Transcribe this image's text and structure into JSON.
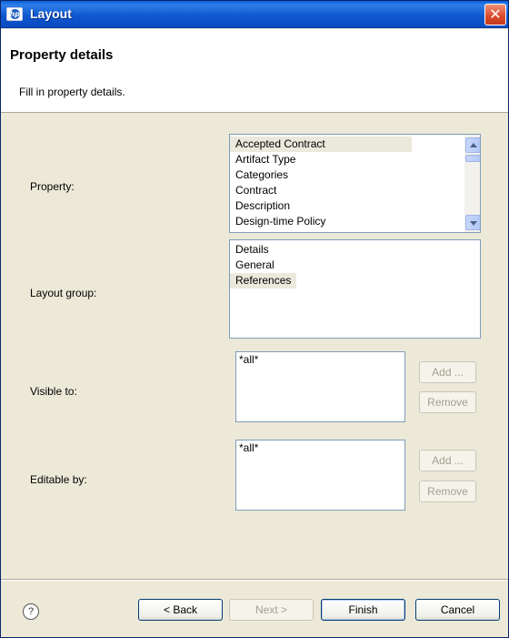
{
  "window": {
    "title": "Layout",
    "close_glyph": "✕"
  },
  "banner": {
    "title": "Property details",
    "description": "Fill in property details."
  },
  "form": {
    "property": {
      "label": "Property:",
      "items": [
        "Accepted Contract",
        "Artifact Type",
        "Categories",
        "Contract",
        "Description",
        "Design-time Policy"
      ],
      "selected": "Accepted Contract"
    },
    "layout_group": {
      "label": "Layout group:",
      "items": [
        "Details",
        "General",
        "References"
      ],
      "selected": "References"
    },
    "visible_to": {
      "label": "Visible to:",
      "items": [
        "*all*"
      ],
      "add_label": "Add ...",
      "remove_label": "Remove"
    },
    "editable_by": {
      "label": "Editable by:",
      "items": [
        "*all*"
      ],
      "add_label": "Add ...",
      "remove_label": "Remove"
    }
  },
  "footer": {
    "help_glyph": "?",
    "back_label": "< Back",
    "next_label": "Next >",
    "finish_label": "Finish",
    "cancel_label": "Cancel"
  },
  "icons": {
    "app": "app-logo-icon",
    "close": "close-icon",
    "help": "help-icon",
    "scroll_up": "chevron-up-icon",
    "scroll_down": "chevron-down-icon"
  },
  "colors": {
    "titlebar": "#0f58d0",
    "dialog_bg": "#ece9d8",
    "selection": "#ebe8dc",
    "list_border": "#7f9db9",
    "close": "#d84a2a"
  }
}
